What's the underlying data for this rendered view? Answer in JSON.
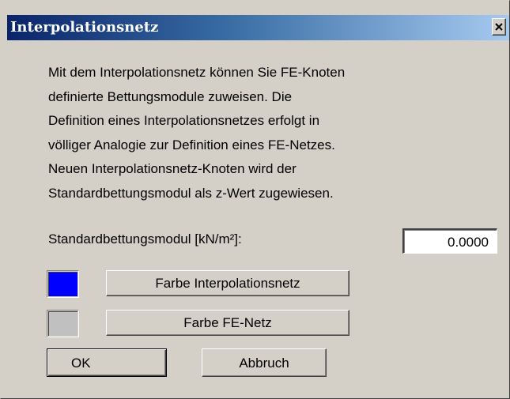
{
  "window": {
    "title": "Interpolationsnetz",
    "close_glyph": "×"
  },
  "description": {
    "lines": [
      "Mit dem Interpolationsnetz können Sie FE-Knoten",
      "definierte Bettungsmodule zuweisen. Die",
      "Definition eines Interpolationsnetzes erfolgt in",
      "völliger Analogie zur Definition eines FE-Netzes.",
      "Neuen Interpolationsnetz-Knoten wird der",
      "Standardbettungsmodul als z-Wert zugewiesen."
    ]
  },
  "modulus": {
    "label": "Standardbettungsmodul [kN/m²]:",
    "value": "0.0000"
  },
  "colors": {
    "interpolation_net": "#0000ff",
    "fe_net": "#c0c0c0",
    "interpolation_button_label": "Farbe Interpolationsnetz",
    "fe_button_label": "Farbe FE-Netz"
  },
  "buttons": {
    "ok": "OK",
    "cancel": "Abbruch"
  }
}
